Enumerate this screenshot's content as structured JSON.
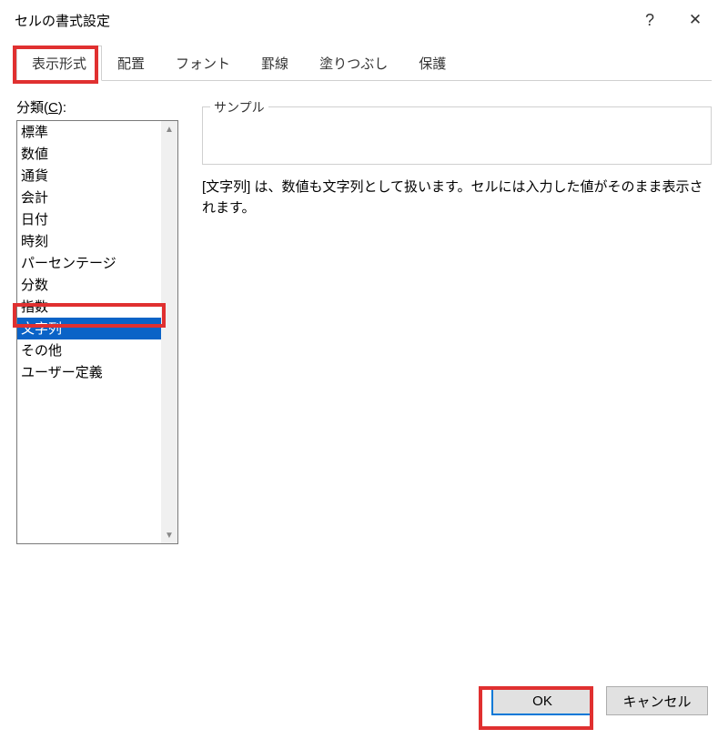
{
  "title": "セルの書式設定",
  "titlebar": {
    "help": "?",
    "close": "✕"
  },
  "tabs": [
    {
      "label": "表示形式",
      "active": true
    },
    {
      "label": "配置",
      "active": false
    },
    {
      "label": "フォント",
      "active": false
    },
    {
      "label": "罫線",
      "active": false
    },
    {
      "label": "塗りつぶし",
      "active": false
    },
    {
      "label": "保護",
      "active": false
    }
  ],
  "category_label_prefix": "分類(",
  "category_label_key": "C",
  "category_label_suffix": "):",
  "categories": [
    {
      "label": "標準",
      "selected": false
    },
    {
      "label": "数値",
      "selected": false
    },
    {
      "label": "通貨",
      "selected": false
    },
    {
      "label": "会計",
      "selected": false
    },
    {
      "label": "日付",
      "selected": false
    },
    {
      "label": "時刻",
      "selected": false
    },
    {
      "label": "パーセンテージ",
      "selected": false
    },
    {
      "label": "分数",
      "selected": false
    },
    {
      "label": "指数",
      "selected": false
    },
    {
      "label": "文字列",
      "selected": true
    },
    {
      "label": "その他",
      "selected": false
    },
    {
      "label": "ユーザー定義",
      "selected": false
    }
  ],
  "sample_label": "サンプル",
  "description": "[文字列] は、数値も文字列として扱います。セルには入力した値がそのまま表示されます。",
  "buttons": {
    "ok": "OK",
    "cancel": "キャンセル"
  },
  "scroll": {
    "up": "▲",
    "down": "▼"
  }
}
